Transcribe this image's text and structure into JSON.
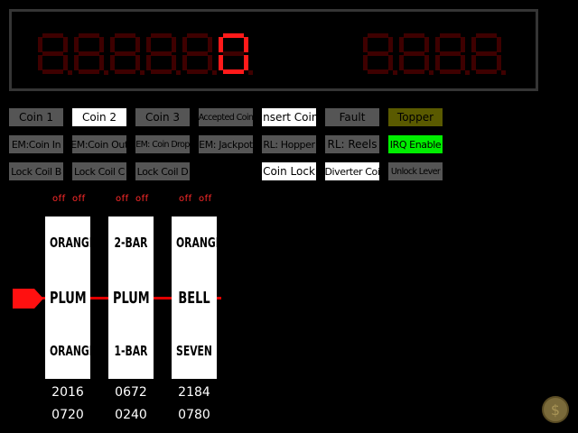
{
  "display": {
    "credit_digits": [
      "8",
      "8",
      "8",
      "8",
      "8",
      "8"
    ],
    "credit_lit": [
      false,
      false,
      false,
      false,
      false,
      true
    ],
    "credit_lit_value": "0",
    "win_digits": [
      "8",
      "8",
      "8",
      "8"
    ],
    "win_lit": [
      false,
      false,
      false,
      false
    ]
  },
  "buttons": {
    "coin1": "Coin 1",
    "coin2": "Coin 2",
    "coin3": "Coin 3",
    "accepted_coin": "Accepted Coin",
    "insert_coin": "Insert Coin",
    "fault": "Fault",
    "topper": "Topper",
    "em_coin_in": "EM:Coin In",
    "em_coin_out": "EM:Coin Out",
    "em_coin_drop": "EM: Coin Drop",
    "em_jackpot": "EM: Jackpot",
    "rl_hopper": "RL: Hopper",
    "rl_reels": "RL: Reels",
    "irq_enable": "IRQ Enable",
    "lock_coil_b": "Lock Coil B",
    "lock_coil_c": "Lock Coil C",
    "lock_coil_d": "Lock Coil D",
    "coin_lock": "Coin Lock",
    "diverter_coil": "Diverter Coi",
    "unlock_lever": "Unlock Lever"
  },
  "reels": [
    {
      "off1": "off",
      "off2": "off",
      "top": "ORANGE",
      "middle": "PLUM",
      "bottom": "ORANGE",
      "count1": "2016",
      "count2": "0720"
    },
    {
      "off1": "off",
      "off2": "off",
      "top": "2-BAR",
      "middle": "PLUM",
      "bottom": "1-BAR",
      "count1": "0672",
      "count2": "0240"
    },
    {
      "off1": "off",
      "off2": "off",
      "top": "ORANGE",
      "middle": "BELL",
      "bottom": "SEVEN",
      "count1": "2184",
      "count2": "0780"
    }
  ],
  "icons": {
    "pointer": "reel-pointer-arrow-icon",
    "coin": "dollar-coin-icon"
  },
  "colors": {
    "segment_on": "#ff1a1a",
    "segment_off": "#3e0000",
    "payline": "#e00000",
    "irq_enable": "#00ee00"
  }
}
